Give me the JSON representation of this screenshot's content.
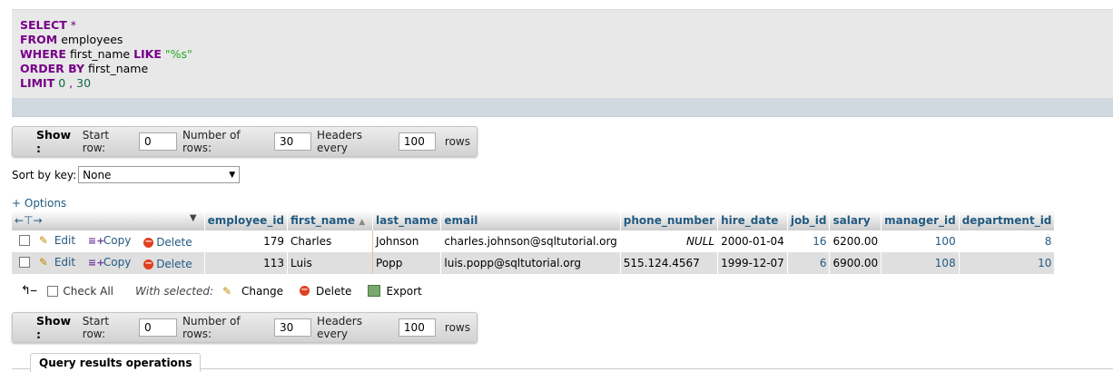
{
  "sql": {
    "select_kw": "SELECT",
    "star": "*",
    "from_kw": "FROM",
    "table": "employees",
    "where_kw": "WHERE",
    "where_col": "first_name",
    "like_kw": "LIKE",
    "pattern": "\"%s\"",
    "order_kw": "ORDER BY",
    "order_col": "first_name",
    "limit_kw": "LIMIT",
    "limit_start": "0",
    "limit_sep": ",",
    "limit_count": "30"
  },
  "nav": {
    "show_label": "Show :",
    "start_row_label": "Start row:",
    "start_row_value": "0",
    "num_rows_label": "Number of rows:",
    "num_rows_value": "30",
    "headers_every_label": "Headers every",
    "headers_every_value": "100",
    "rows_label": "rows"
  },
  "sort": {
    "label": "Sort by key:",
    "value": "None"
  },
  "options_link": "+ Options",
  "table": {
    "columns": [
      "employee_id",
      "first_name",
      "last_name",
      "email",
      "phone_number",
      "hire_date",
      "job_id",
      "salary",
      "manager_id",
      "department_id"
    ],
    "actions": {
      "edit": "Edit",
      "copy": "Copy",
      "delete": "Delete"
    },
    "rows": [
      [
        "179",
        "Charles",
        "Johnson",
        "charles.johnson@sqltutorial.org",
        "NULL",
        "2000-01-04",
        "16",
        "6200.00",
        "100",
        "8"
      ],
      [
        "113",
        "Luis",
        "Popp",
        "luis.popp@sqltutorial.org",
        "515.124.4567",
        "1999-12-07",
        "6",
        "6900.00",
        "108",
        "10"
      ]
    ]
  },
  "with_selected": {
    "check_all": "Check All",
    "label": "With selected:",
    "change": "Change",
    "delete": "Delete",
    "export": "Export"
  },
  "bottom_tab": "Query results operations"
}
